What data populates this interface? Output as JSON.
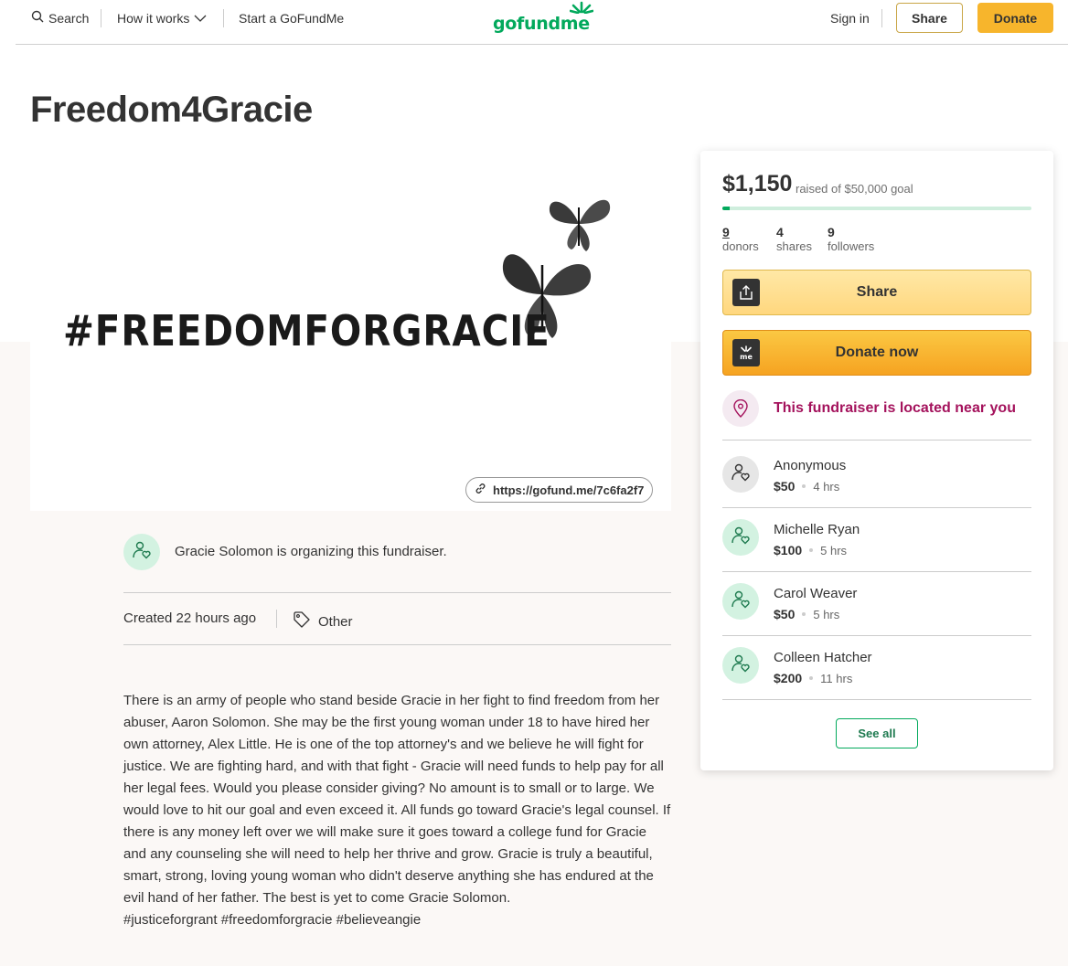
{
  "header": {
    "search_label": "Search",
    "how_it_works_label": "How it works",
    "start_label": "Start a GoFundMe",
    "logo_text": "gofundme",
    "signin_label": "Sign in",
    "share_label": "Share",
    "donate_label": "Donate"
  },
  "campaign": {
    "title": "Freedom4Gracie",
    "hero_text": "#FREEDOMFORGRACIE",
    "short_link": "https://gofund.me/7c6fa2f7",
    "organizer_text": "Gracie Solomon is organizing this fundraiser.",
    "created": "Created 22 hours ago",
    "category": "Other",
    "story": [
      "There is an army of people who stand beside Gracie in her fight to find freedom from her abuser, Aaron Solomon.   She may be the first young woman under 18 to have hired her own attorney, Alex Little.  He is one of the top attorney's and we believe he will fight for justice. We are fighting hard, and with that fight - Gracie will need funds to help pay for all her legal fees.  Would you please consider giving?  No amount is to small or to large.  We would love to hit our goal and even exceed it.  All funds go toward Gracie's legal counsel. If there is any money left over we will make sure it goes toward a college fund for Gracie and any counseling she will need to help her thrive and grow. Gracie is truly a beautiful, smart, strong, loving young woman who didn't deserve anything she has endured at the evil hand of her father. The best is yet to come Gracie Solomon.",
      "#justiceforgrant #freedomforgracie #believeangie"
    ]
  },
  "sidebar": {
    "raised": "$1,150",
    "goal_text": "raised of $50,000 goal",
    "progress_fraction": 0.023,
    "stats": [
      {
        "value": "9",
        "label": "donors"
      },
      {
        "value": "4",
        "label": "shares"
      },
      {
        "value": "9",
        "label": "followers"
      }
    ],
    "share_button": "Share",
    "donate_button": "Donate now",
    "near_text": "This fundraiser is located near you",
    "donations": [
      {
        "name": "Anonymous",
        "amount": "$50",
        "time": "4 hrs"
      },
      {
        "name": "Michelle Ryan",
        "amount": "$100",
        "time": "5 hrs"
      },
      {
        "name": "Carol Weaver",
        "amount": "$50",
        "time": "5 hrs"
      },
      {
        "name": "Colleen Hatcher",
        "amount": "$200",
        "time": "11 hrs"
      }
    ],
    "see_all_label": "See all"
  },
  "colors": {
    "brand_green": "#02a95c",
    "donate_orange": "#f7b52c",
    "near_purple": "#a4125c"
  },
  "icons": [
    "search-icon",
    "chevron-down-icon",
    "link-icon",
    "tag-icon",
    "heart-person-icon",
    "share-upload-icon",
    "gofundme-me-icon",
    "location-pin-icon",
    "butterfly-icon"
  ]
}
